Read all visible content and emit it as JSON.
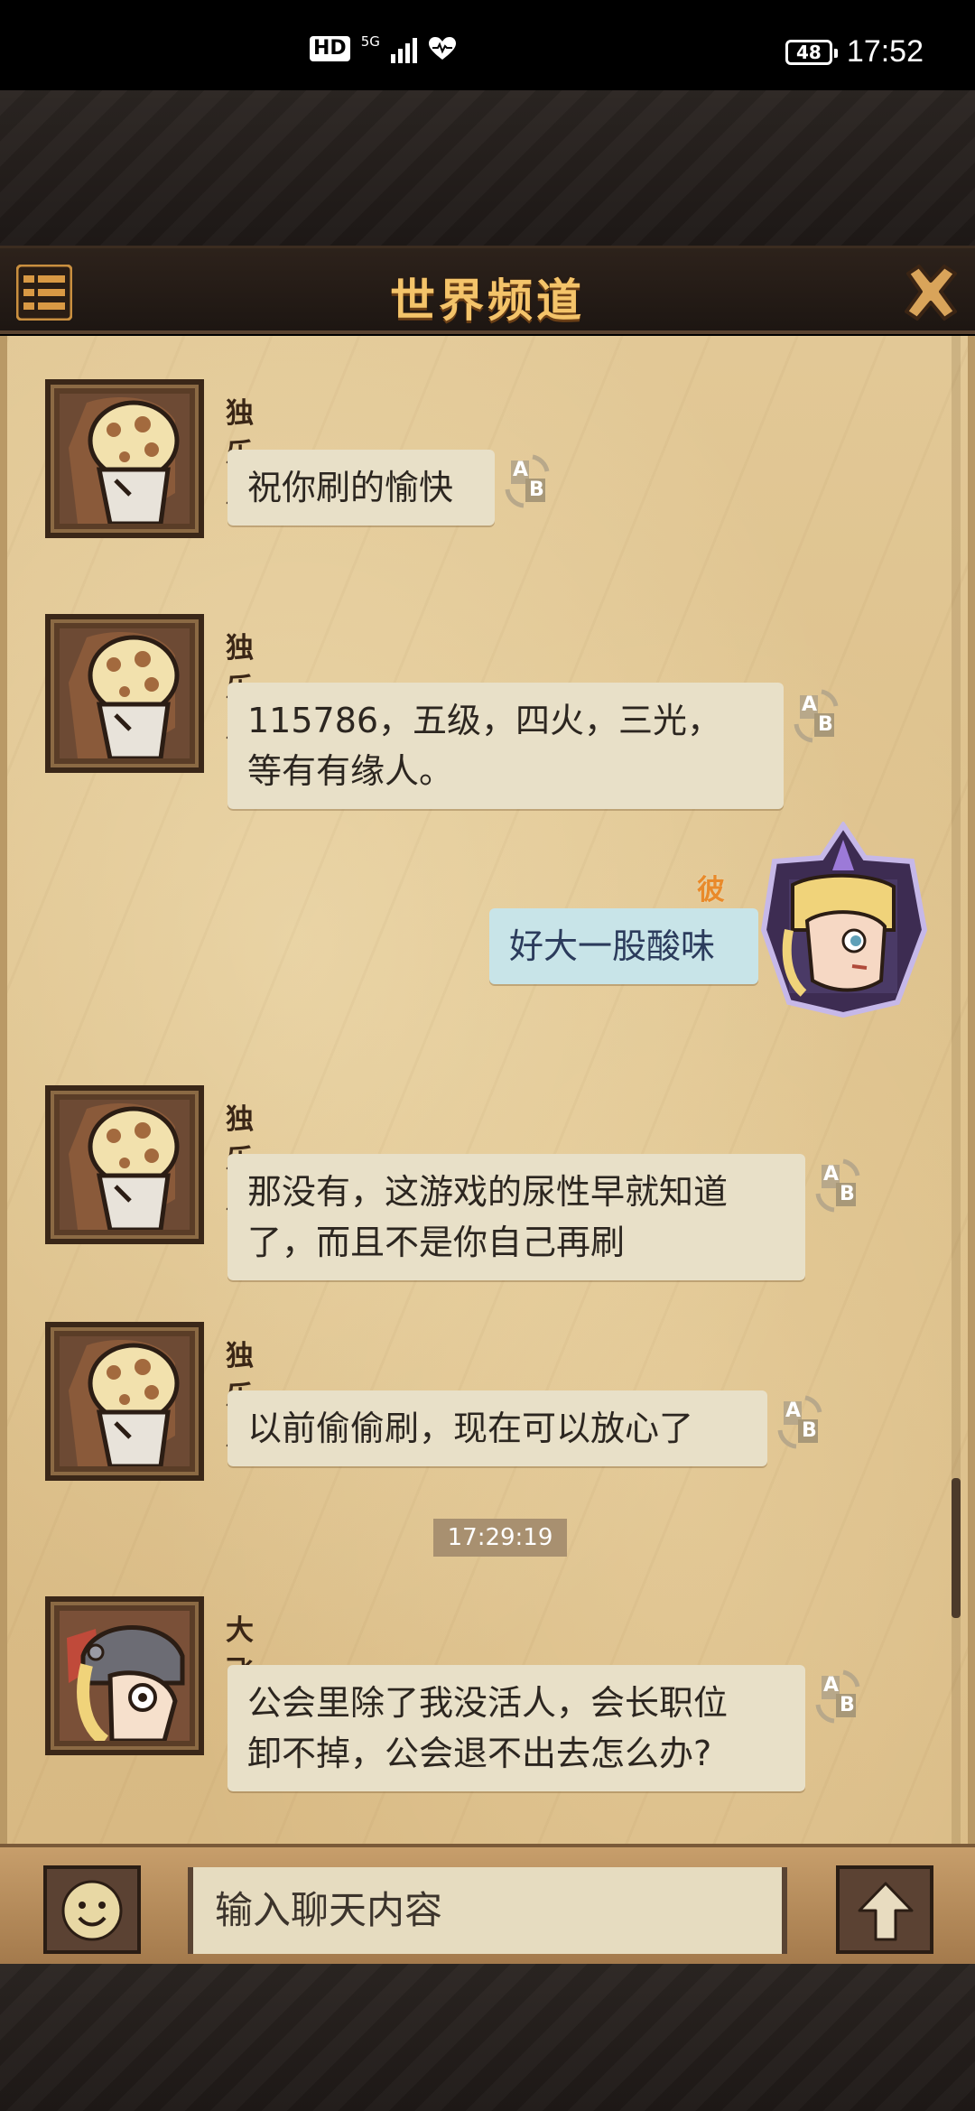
{
  "status_bar": {
    "hd": "HD",
    "signal_label": "5G",
    "battery": "48",
    "time": "17:52",
    "icons": [
      "hd-icon",
      "signal-icon",
      "heart-pulse-icon",
      "battery-icon"
    ]
  },
  "header": {
    "title": "世界频道",
    "menu_icon": "menu-icon",
    "close_icon": "close-icon"
  },
  "messages": [
    {
      "sender": "独乐乐",
      "text_lines": [
        "祝你刷的愉快"
      ],
      "mine": false
    },
    {
      "sender": "独乐乐",
      "text_lines": [
        "115786，五级，四火，三光，",
        "等有有缘人。"
      ],
      "mine": false
    },
    {
      "sender": "彼岸",
      "text_lines": [
        "好大一股酸味"
      ],
      "mine": true
    },
    {
      "sender": "独乐乐",
      "text_lines": [
        "那没有，这游戏的尿性早就知道",
        "了，而且不是你自己再刷"
      ],
      "mine": false
    },
    {
      "sender": "独乐乐",
      "text_lines": [
        "以前偷偷刷，现在可以放心了"
      ],
      "mine": false
    },
    {
      "sender": "大飞",
      "text_lines": [
        "公会里除了我没活人，会长职位",
        "卸不掉，公会退不出去怎么办?"
      ],
      "mine": false
    }
  ],
  "timestamp": "17:29:19",
  "translate_icon": {
    "a": "A",
    "b": "B"
  },
  "input": {
    "placeholder": "输入聊天内容",
    "emoji_icon": "emoji-icon",
    "send_icon": "send-arrow-icon"
  },
  "colors": {
    "title": "#f4c46a",
    "my_name": "#e98a2a",
    "my_bubble": "#c8e4e8",
    "bubble": "#e8e0c8"
  }
}
